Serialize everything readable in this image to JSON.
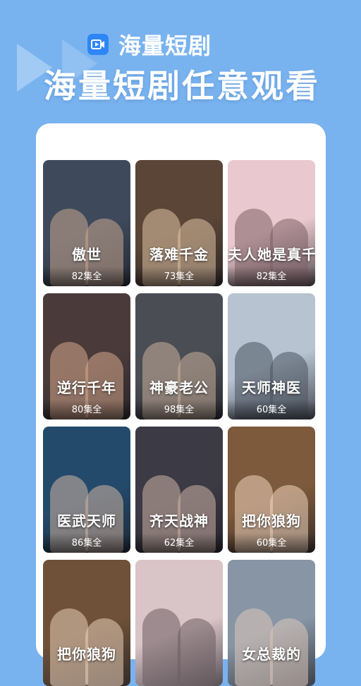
{
  "app": {
    "brand_name": "海量短剧",
    "headline": "海量短剧任意观看"
  },
  "dramas": [
    {
      "title": "傲世",
      "episodes": "82集全",
      "bg": "#3e4a5c",
      "fig": "#c9a78f"
    },
    {
      "title": "落难千金",
      "episodes": "73集全",
      "bg": "#5a4536",
      "fig": "#e0c2a4"
    },
    {
      "title": "夫人她是真千金",
      "episodes": "82集全",
      "bg": "#e9c9cf",
      "fig": "#7b5f65"
    },
    {
      "title": "逆行千年",
      "episodes": "80集全",
      "bg": "#4a3b3a",
      "fig": "#d6a88c"
    },
    {
      "title": "神豪老公",
      "episodes": "98集全",
      "bg": "#4b4d55",
      "fig": "#c8b09a"
    },
    {
      "title": "天师神医",
      "episodes": "60集全",
      "bg": "#b7c3d1",
      "fig": "#4b5360"
    },
    {
      "title": "医武天师",
      "episodes": "86集全",
      "bg": "#244a6b",
      "fig": "#d0b5a2"
    },
    {
      "title": "齐天战神",
      "episodes": "62集全",
      "bg": "#3c3a44",
      "fig": "#cdb3a6"
    },
    {
      "title": "把你狼狗",
      "episodes": "60集全",
      "bg": "#7d5a3b",
      "fig": "#f0d6bf"
    },
    {
      "title": "把你狼狗",
      "episodes": "",
      "bg": "#6e5138",
      "fig": "#ead0ba"
    },
    {
      "title": "",
      "episodes": "",
      "bg": "#d9c4c8",
      "fig": "#6b5c60"
    },
    {
      "title": "女总裁的",
      "episodes": "",
      "bg": "#8795a5",
      "fig": "#dcc7ba"
    }
  ]
}
